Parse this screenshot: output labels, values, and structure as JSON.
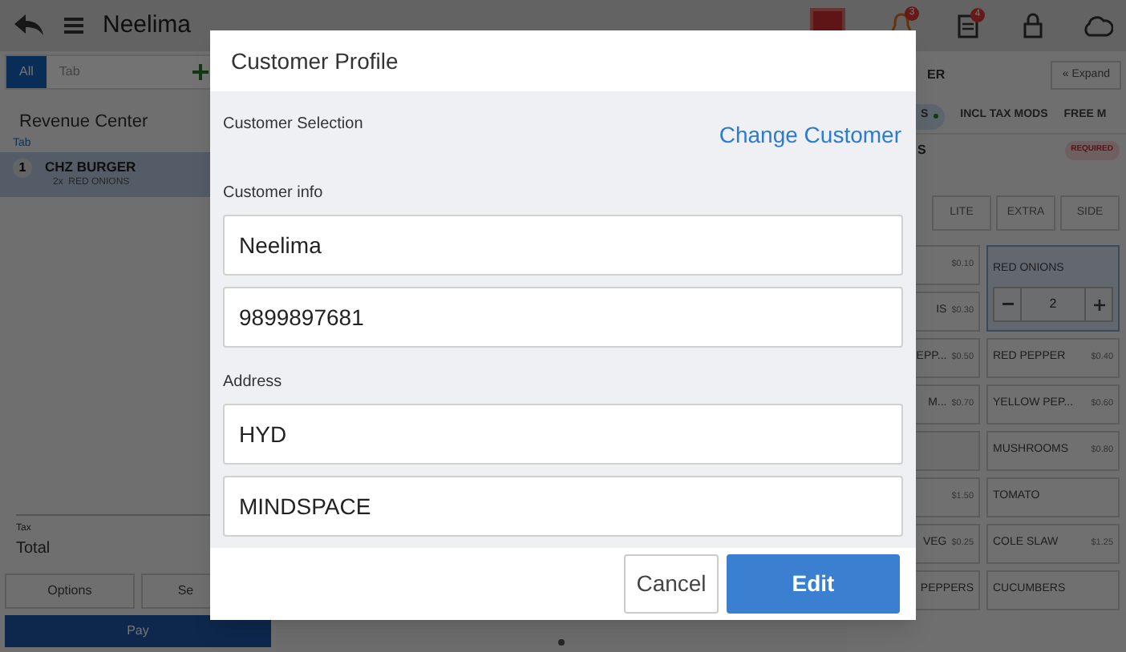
{
  "top_bar": {
    "title": "Neelima",
    "badges": [
      "3",
      "4"
    ]
  },
  "order_panel": {
    "tabs": [
      {
        "label": "All",
        "selected": true
      },
      {
        "label": "Tab",
        "selected": false
      }
    ],
    "revenue_center": "Revenue Center",
    "tab_label": "Tab",
    "items": [
      {
        "qty": "1",
        "name": "CHZ BURGER",
        "modifier": "2x  RED ONIONS",
        "selected": true
      }
    ],
    "tax_label": "Tax",
    "total_label": "Total",
    "buttons": [
      "Options",
      "Se"
    ],
    "pay": "Pay"
  },
  "modifier_panel": {
    "heading": "ER",
    "expand": "« Expand",
    "chips": [
      {
        "label": "S",
        "selected": true
      },
      {
        "label": "INCL TAX MODS",
        "selected": false
      },
      {
        "label": "FREE M",
        "selected": false
      }
    ],
    "group": "S",
    "required": "REQUIRED",
    "size_options": [
      "LITE",
      "EXTRA",
      "SIDE"
    ],
    "left_column": [
      {
        "kind": "modifier",
        "price": "$0.10"
      },
      {
        "kind": "modifier",
        "name": "IS",
        "price": "$0.30"
      },
      {
        "kind": "modifier",
        "name": "EPP...",
        "price": "$0.50"
      },
      {
        "kind": "modifier",
        "name": "M...",
        "price": "$0.70"
      },
      {
        "kind": "blank"
      },
      {
        "kind": "modifier",
        "price": "$1.50"
      },
      {
        "kind": "modifier",
        "name": "VEG",
        "price": "$0.25"
      },
      {
        "kind": "modifier",
        "name": "PEPPERS"
      }
    ],
    "right_column": [
      {
        "name": "RED ONIONS",
        "selected": true,
        "quantity": "2"
      },
      {
        "name": "RED PEPPER",
        "price": "$0.40",
        "selected": false
      },
      {
        "name": "YELLOW PEP...",
        "price": "$0.60",
        "selected": false
      },
      {
        "name": "MUSHROOMS",
        "price": "$0.80",
        "selected": false
      },
      {
        "name": "TOMATO",
        "selected": false
      },
      {
        "name": "COLE SLAW",
        "price": "$1.25",
        "selected": false
      },
      {
        "name": "CUCUMBERS",
        "selected": false
      }
    ]
  },
  "dialog": {
    "title": "Customer Profile",
    "selection_label": "Customer Selection",
    "change_link": "Change Customer",
    "info_label": "Customer info",
    "info_fields": [
      "Neelima",
      "9899897681"
    ],
    "address_label": "Address",
    "address_fields": [
      "HYD",
      "MINDSPACE"
    ],
    "buttons": [
      {
        "label": "Cancel",
        "kind": "secondary"
      },
      {
        "label": "Edit",
        "kind": "primary"
      }
    ]
  }
}
